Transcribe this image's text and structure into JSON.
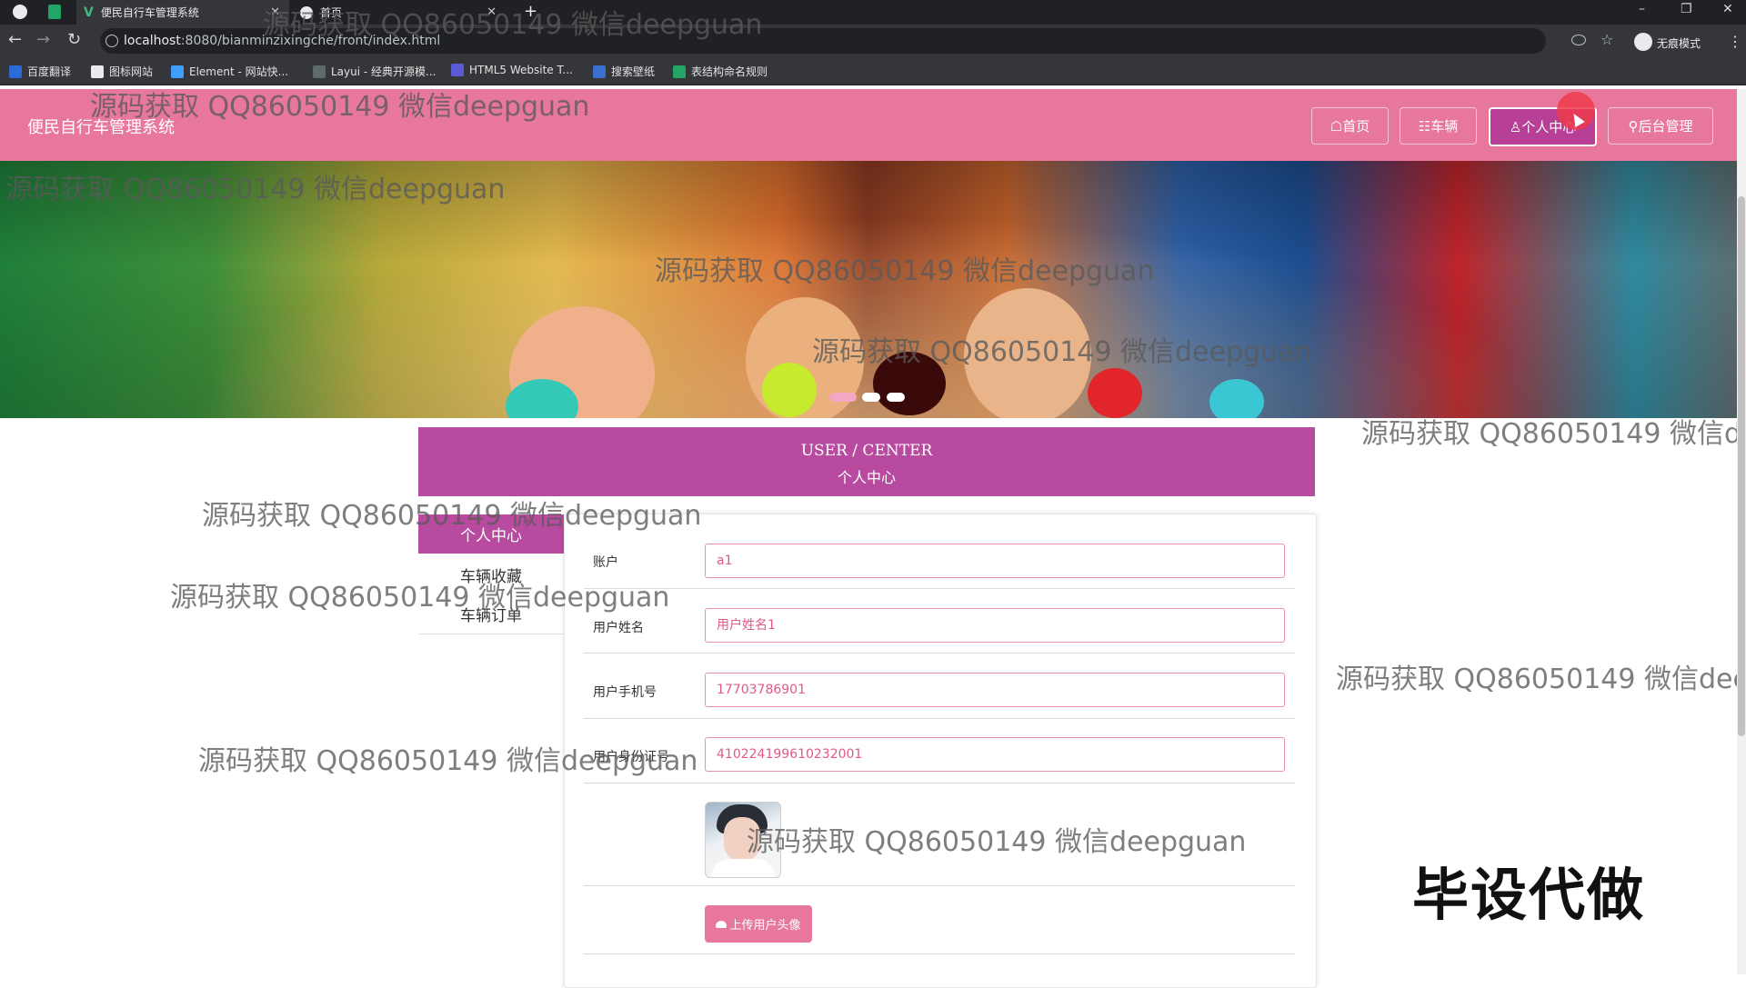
{
  "browser": {
    "tabs": [
      {
        "title": "便民自行车管理系统",
        "active": true
      },
      {
        "title": "首页",
        "active": false
      }
    ],
    "new_tab": "+",
    "url_host": "localhost",
    "url_rest": ":8080/bianminzixingche/front/index.html",
    "incognito_label": "无痕模式",
    "bookmarks": [
      "百度翻译",
      "图标网站",
      "Element - 网站快...",
      "Layui - 经典开源模...",
      "HTML5 Website T...",
      "搜索壁纸",
      "表结构命名规则"
    ],
    "controls": {
      "minimize": "–",
      "restore": "❐",
      "close": "✕",
      "back": "←",
      "forward": "→",
      "reload": "↻",
      "menu": "⋮"
    }
  },
  "header": {
    "site_title": "便民自行车管理系统",
    "nav": [
      {
        "label": "首页",
        "icon": "☖"
      },
      {
        "label": "车辆",
        "icon": "☷"
      },
      {
        "label": "个人中心",
        "icon": "♙"
      },
      {
        "label": "后台管理",
        "icon": "⚲"
      }
    ]
  },
  "user_center": {
    "title_en": "USER / CENTER",
    "title_cn": "个人中心"
  },
  "sidebar": {
    "items": [
      {
        "label": "个人中心",
        "active": true
      },
      {
        "label": "车辆收藏",
        "active": false
      },
      {
        "label": "车辆订单",
        "active": false
      }
    ]
  },
  "form": {
    "fields": [
      {
        "label": "账户",
        "value": "a1"
      },
      {
        "label": "用户姓名",
        "value": "用户姓名1"
      },
      {
        "label": "用户手机号",
        "value": "17703786901"
      },
      {
        "label": "用户身份证号",
        "value": "410224199610232001"
      }
    ],
    "upload_label": "上传用户头像"
  },
  "watermark_text": "源码获取 QQ86050149 微信deepguan",
  "promo_text": "毕设代做",
  "colors": {
    "header_pink": "#e7789b",
    "accent_purple": "#b84aa0",
    "input_border": "#e990ad"
  }
}
